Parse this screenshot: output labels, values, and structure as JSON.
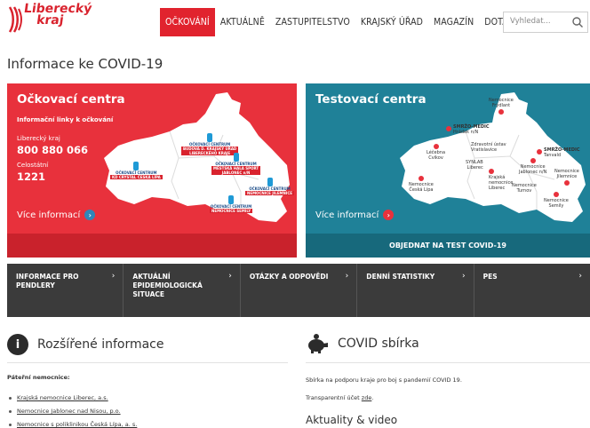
{
  "header": {
    "logo_text_1": "Liberecký",
    "logo_text_2": "kraj",
    "nav": [
      {
        "label": "OČKOVÁNÍ",
        "active": true
      },
      {
        "label": "AKTUÁLNĚ",
        "active": false
      },
      {
        "label": "ZASTUPITELSTVO",
        "active": false
      },
      {
        "label": "KRAJSKÝ ÚŘAD",
        "active": false
      },
      {
        "label": "MAGAZÍN",
        "active": false
      },
      {
        "label": "DOTACE",
        "active": false
      }
    ],
    "search": {
      "placeholder": "Vyhledat...",
      "icon": "search-icon"
    }
  },
  "page_title": "Informace ke COVID-19",
  "vaccination": {
    "title": "Očkovací centra",
    "subtitle": "Informační linky k očkování",
    "region_label": "Liberecký kraj",
    "region_phone": "800 880 066",
    "national_label": "Celostátní",
    "national_phone": "1221",
    "more": "Více informací",
    "centers": [
      {
        "l1": "OČKOVACÍ CENTRUM",
        "l2": "BUDOVA D. KRAJSKÝ ÚŘAD",
        "l3": "LIBERECKÉHO KRAJE"
      },
      {
        "l1": "OČKOVACÍ CENTRUM",
        "l2": "KD CRYSTAL ČESKÁ LÍPA"
      },
      {
        "l1": "OČKOVACÍ CENTRUM",
        "l2": "MĚSTSKÁ HALA SPORT",
        "l3": "JABLONEC n/N"
      },
      {
        "l1": "OČKOVACÍ CENTRUM",
        "l2": "NEMOCNICE JILEMNICE"
      },
      {
        "l1": "OČKOVACÍ CENTRUM",
        "l2": "NEMOCNICE SEMILY"
      }
    ],
    "accent": "#e8313c"
  },
  "testing": {
    "title": "Testovací centra",
    "more": "Více informací",
    "order": "OBJEDNAT NA TEST COVID-19",
    "centers": [
      {
        "l1": "Nemocnice",
        "l2": "Frýdlant"
      },
      {
        "l1": "SMRŽO-MEDIC",
        "l2": "Hrádek n/N"
      },
      {
        "l1": "Zdravotní ústav",
        "l2": "Vratislavice"
      },
      {
        "l1": "Léčebna",
        "l2": "Cvikov"
      },
      {
        "l1": "SYNLAB",
        "l2": "Liberec"
      },
      {
        "l1": "Krajská",
        "l2": "nemocnice",
        "l3": "Liberec"
      },
      {
        "l1": "Nemocnice",
        "l2": "Jablonec n/N"
      },
      {
        "l1": "SMRŽO-MEDIC",
        "l2": "Tanvald"
      },
      {
        "l1": "Nemocnice",
        "l2": "Česká Lípa"
      },
      {
        "l1": "Nemocnice",
        "l2": "Jilemnice"
      },
      {
        "l1": "Nemocnice",
        "l2": "Turnov"
      },
      {
        "l1": "Nemocnice",
        "l2": "Semily"
      }
    ],
    "accent": "#1f8198"
  },
  "quick_links": [
    {
      "l1": "INFORMACE PRO",
      "l2": "PENDLERY"
    },
    {
      "l1": "AKTUÁLNÍ",
      "l2": "EPIDEMIOLOGICKÁ",
      "l3": "SITUACE"
    },
    {
      "l1": "OTÁZKY A ODPOVĚDI"
    },
    {
      "l1": "DENNÍ STATISTIKY"
    },
    {
      "l1": "PES"
    }
  ],
  "extended_info": {
    "title": "Rozšířené informace",
    "icon": "info-icon",
    "subheading": "Páteřní nemocnice:",
    "hospitals": [
      "Krajská nemocnice Liberec, a.s.",
      "Nemocnice Jablonec nad Nisou, p.o.",
      "Nemocnice s poliklinikou Česká Lípa, a. s."
    ]
  },
  "collection": {
    "title": "COVID sbírka",
    "icon": "piggy-bank-icon",
    "text": "Sbírka na podporu kraje pro boj s pandemií COVID 19.",
    "account_prefix": "Transparentní účet ",
    "account_link": "zde",
    "account_suffix": "."
  },
  "news": {
    "title": "Aktuality & video"
  }
}
